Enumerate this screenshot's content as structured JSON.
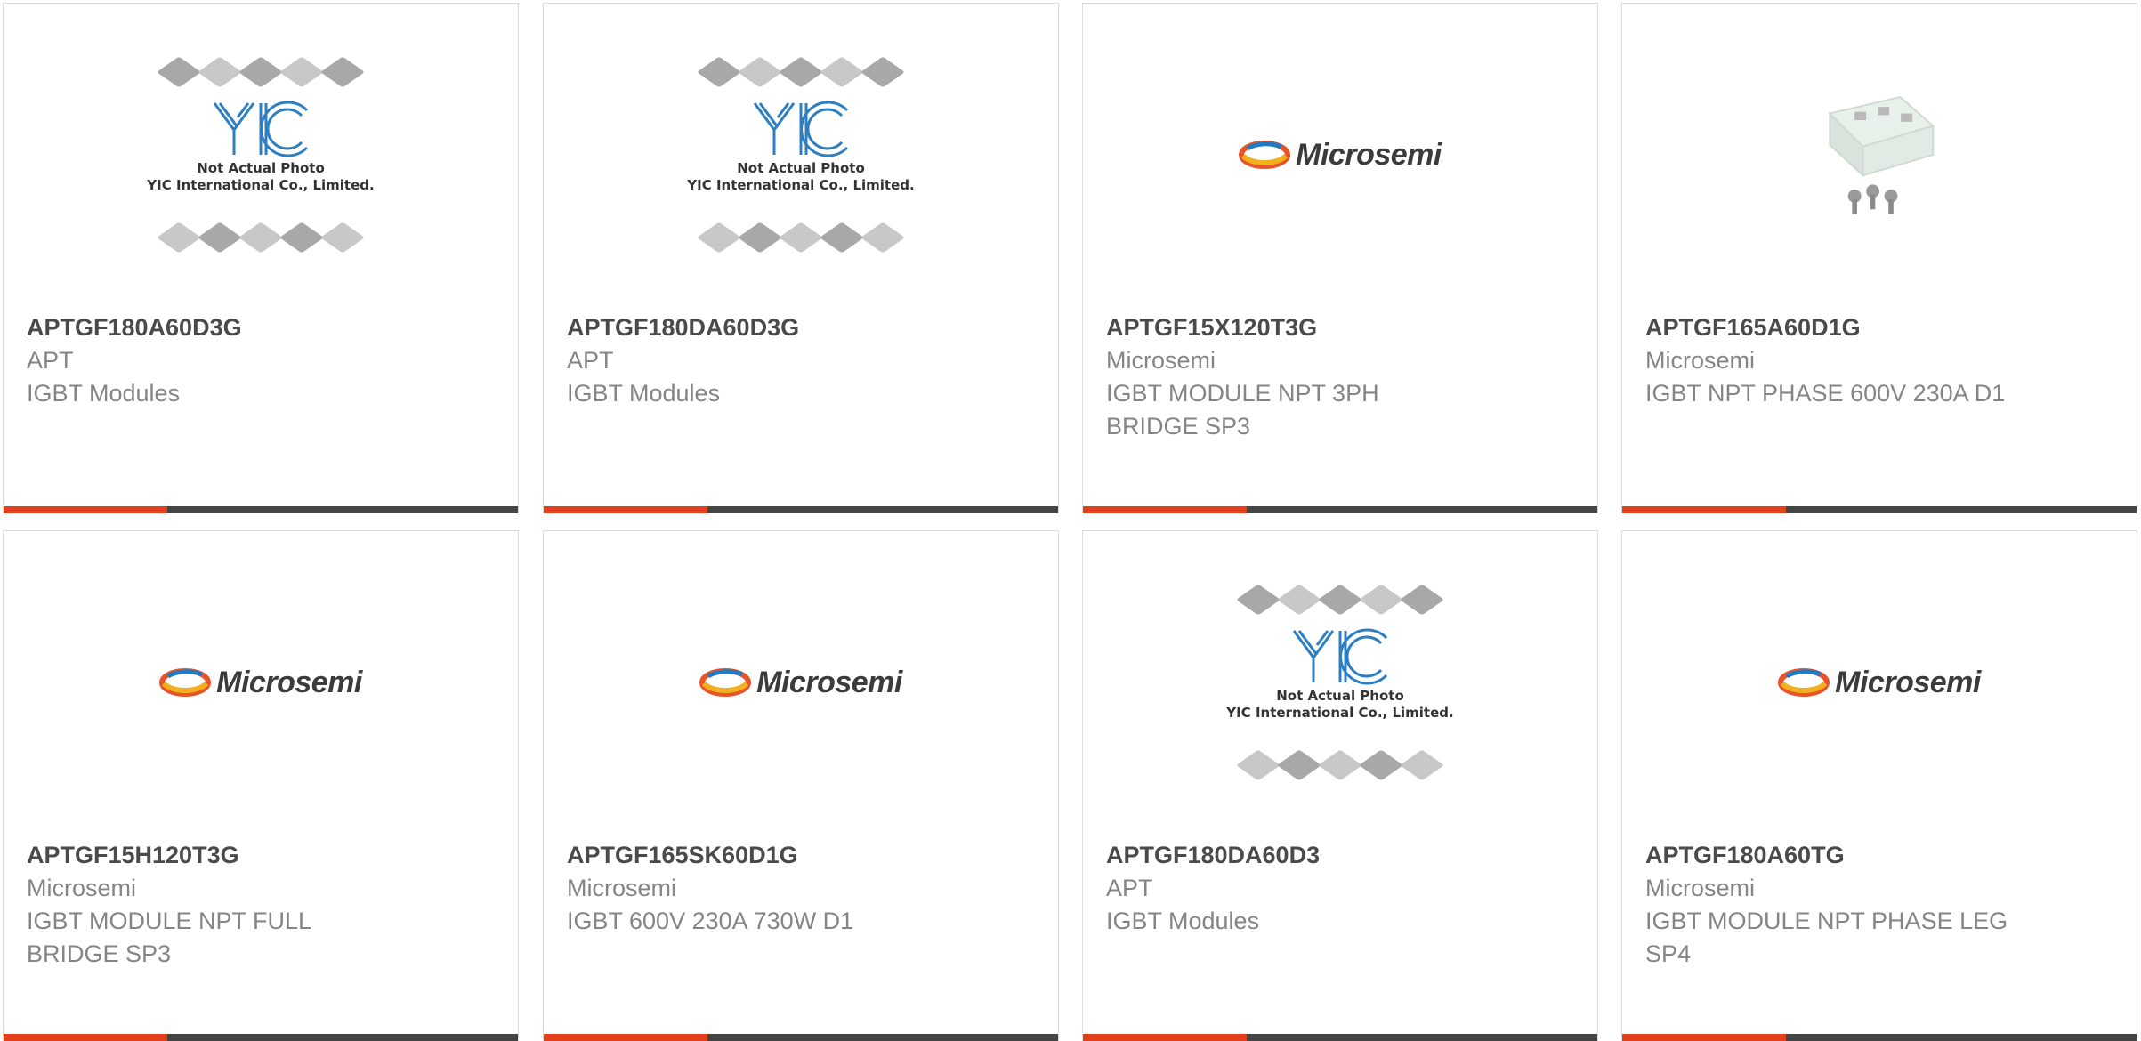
{
  "colors": {
    "accent": "#e2401c",
    "bar_dark": "#444444",
    "border": "#dcdcdc"
  },
  "placeholder": {
    "line1": "Not Actual Photo",
    "line2": "YIC International Co., Limited."
  },
  "brand_logo_text": "Microsemi",
  "products": [
    {
      "part_number": "APTGF180A60D3G",
      "manufacturer": "APT",
      "description_lines": [
        "IGBT Modules"
      ],
      "image": "yic-placeholder"
    },
    {
      "part_number": "APTGF180DA60D3G",
      "manufacturer": "APT",
      "description_lines": [
        "IGBT Modules"
      ],
      "image": "yic-placeholder"
    },
    {
      "part_number": "APTGF15X120T3G",
      "manufacturer": "Microsemi",
      "description_lines": [
        "IGBT MODULE NPT 3PH",
        "BRIDGE SP3"
      ],
      "image": "microsemi-logo"
    },
    {
      "part_number": "APTGF165A60D1G",
      "manufacturer": "Microsemi",
      "description_lines": [
        "IGBT NPT PHASE 600V 230A D1"
      ],
      "image": "module-photo"
    },
    {
      "part_number": "APTGF15H120T3G",
      "manufacturer": "Microsemi",
      "description_lines": [
        "IGBT MODULE NPT FULL",
        "BRIDGE SP3"
      ],
      "image": "microsemi-logo"
    },
    {
      "part_number": "APTGF165SK60D1G",
      "manufacturer": "Microsemi",
      "description_lines": [
        "IGBT 600V 230A 730W D1"
      ],
      "image": "microsemi-logo"
    },
    {
      "part_number": "APTGF180DA60D3",
      "manufacturer": "APT",
      "description_lines": [
        "IGBT Modules"
      ],
      "image": "yic-placeholder"
    },
    {
      "part_number": "APTGF180A60TG",
      "manufacturer": "Microsemi",
      "description_lines": [
        "IGBT MODULE NPT PHASE LEG",
        "SP4"
      ],
      "image": "microsemi-logo"
    }
  ]
}
